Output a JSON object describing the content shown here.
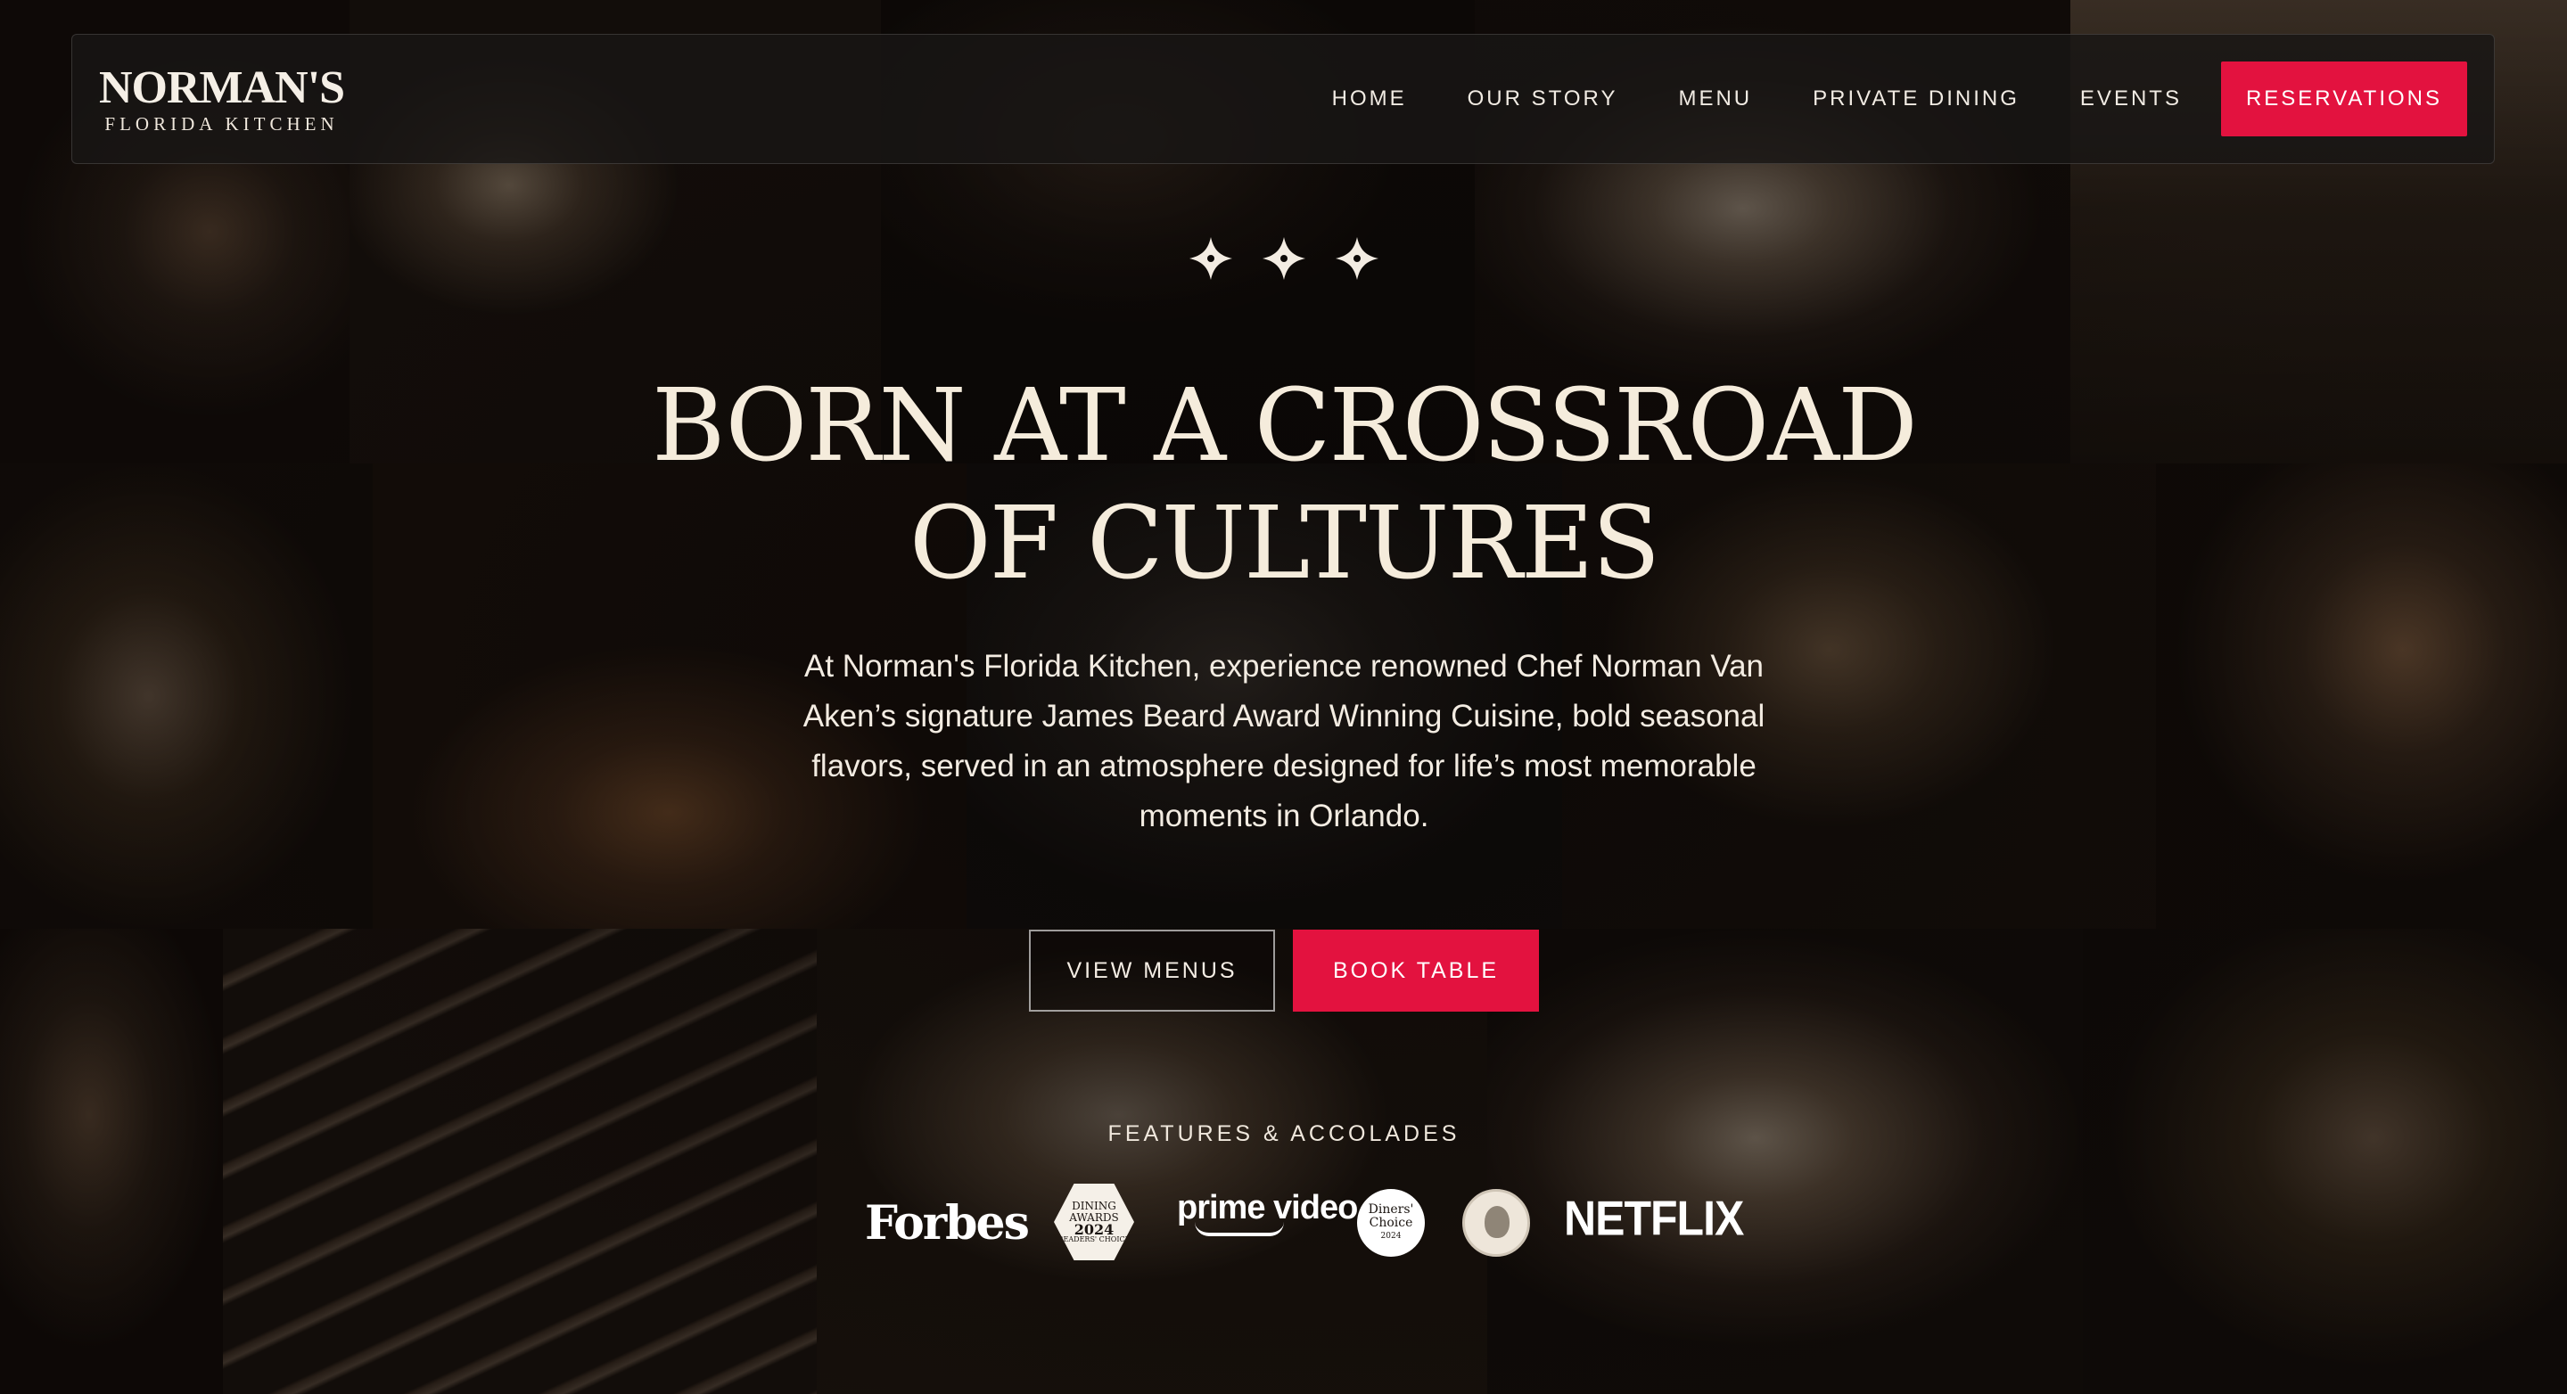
{
  "brand": {
    "name": "NORMAN'S",
    "tagline": "FLORIDA KITCHEN"
  },
  "nav": {
    "items": [
      {
        "label": "HOME"
      },
      {
        "label": "OUR STORY"
      },
      {
        "label": "MENU"
      },
      {
        "label": "PRIVATE DINING"
      },
      {
        "label": "EVENTS"
      }
    ],
    "cta_label": "RESERVATIONS"
  },
  "hero": {
    "title_line1": "BORN AT A CROSSROAD",
    "title_line2": "OF CULTURES",
    "description": "At Norman's Florida Kitchen, experience renowned Chef Norman Van Aken’s signature James Beard Award Winning Cuisine, bold seasonal flavors, served in an atmosphere designed for life’s most memorable moments in Orlando.",
    "primary_button": "VIEW MENUS",
    "secondary_button": "BOOK TABLE"
  },
  "accolades": {
    "label": "FEATURES & ACCOLADES",
    "logos": {
      "forbes": "Forbes",
      "dining_awards": {
        "line1": "DINING",
        "line2": "AWARDS",
        "year": "2024",
        "line3": "READERS' CHOICE"
      },
      "prime_video": "prime video",
      "diners_choice": {
        "line1": "Diners'",
        "line2": "Choice",
        "year": "2024"
      },
      "netflix": "NETFLIX"
    }
  },
  "colors": {
    "accent": "#e3123f",
    "text": "#f3ece2",
    "header_bg": "#181615"
  },
  "icons": [
    "fleur-star-icon",
    "fleur-star-icon",
    "fleur-star-icon"
  ]
}
